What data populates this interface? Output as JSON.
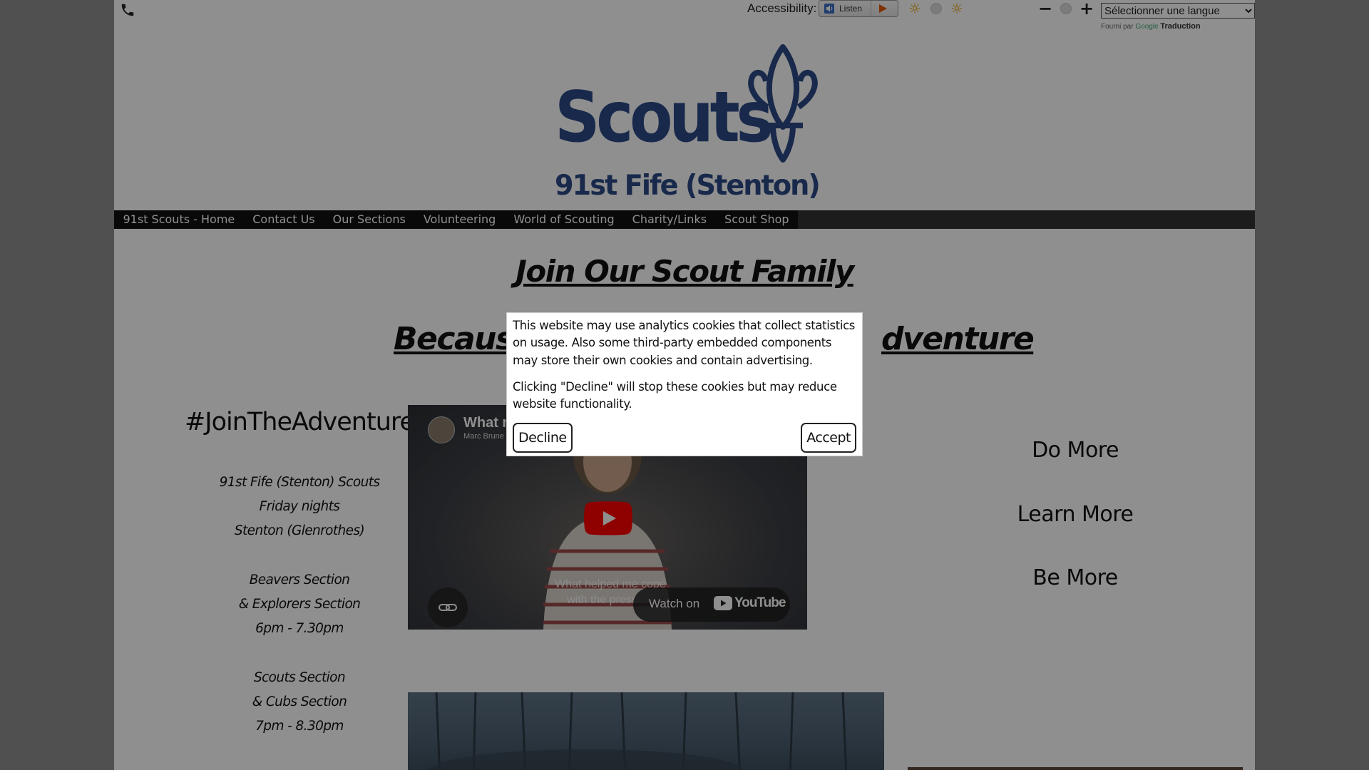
{
  "topbar": {
    "accessibility_label": "Accessibility:",
    "listen_label": "Listen",
    "language_select": {
      "value": "Sélectionner une langue"
    },
    "powered_by": {
      "prefix": "Fourni par",
      "google": "Google",
      "service": "Traduction"
    }
  },
  "logo": {
    "line1": "Scouts",
    "line2": "91st Fife (Stenton)"
  },
  "nav": {
    "items": [
      {
        "label": "91st Scouts - Home"
      },
      {
        "label": "Contact Us"
      },
      {
        "label": "Our Sections"
      },
      {
        "label": "Volunteering"
      },
      {
        "label": "World of Scouting"
      },
      {
        "label": "Charity/Links"
      },
      {
        "label": "Scout Shop"
      }
    ]
  },
  "main": {
    "heading": "Join Our Scout Family",
    "subheading_left": "Because",
    "subheading_right": "dventure",
    "hashtag": "#JoinTheAdventure",
    "info_lines": [
      "91st Fife (Stenton) Scouts",
      "Friday nights",
      "Stenton (Glenrothes)",
      "",
      "Beavers Section",
      "& Explorers Section",
      "6pm - 7.30pm",
      "",
      "Scouts Section",
      "& Cubs Section",
      "7pm - 8.30pm"
    ],
    "right_links": [
      "Do More",
      "Learn More",
      "Be More"
    ]
  },
  "video": {
    "title": "What m",
    "channel": "Marc Brune",
    "caption_line1": "What helped me cope",
    "caption_line2": "with the pressure",
    "watch_on": "Watch on",
    "youtube": "YouTube"
  },
  "cookie_dialog": {
    "text1": "This website may use analytics cookies that collect statistics on usage. Also some third-party embedded components may store their own cookies and contain advertising.",
    "text2": "Clicking \"Decline\" will stop these cookies but may reduce website functionality.",
    "decline_label": "Decline",
    "accept_label": "Accept"
  },
  "colors": {
    "logo_blue": "#2c4a86",
    "nav_bg": "#111111",
    "nav_bar": "#333333",
    "overlay": "rgba(0,0,0,0.44)",
    "youtube_red": "#ff0000"
  }
}
